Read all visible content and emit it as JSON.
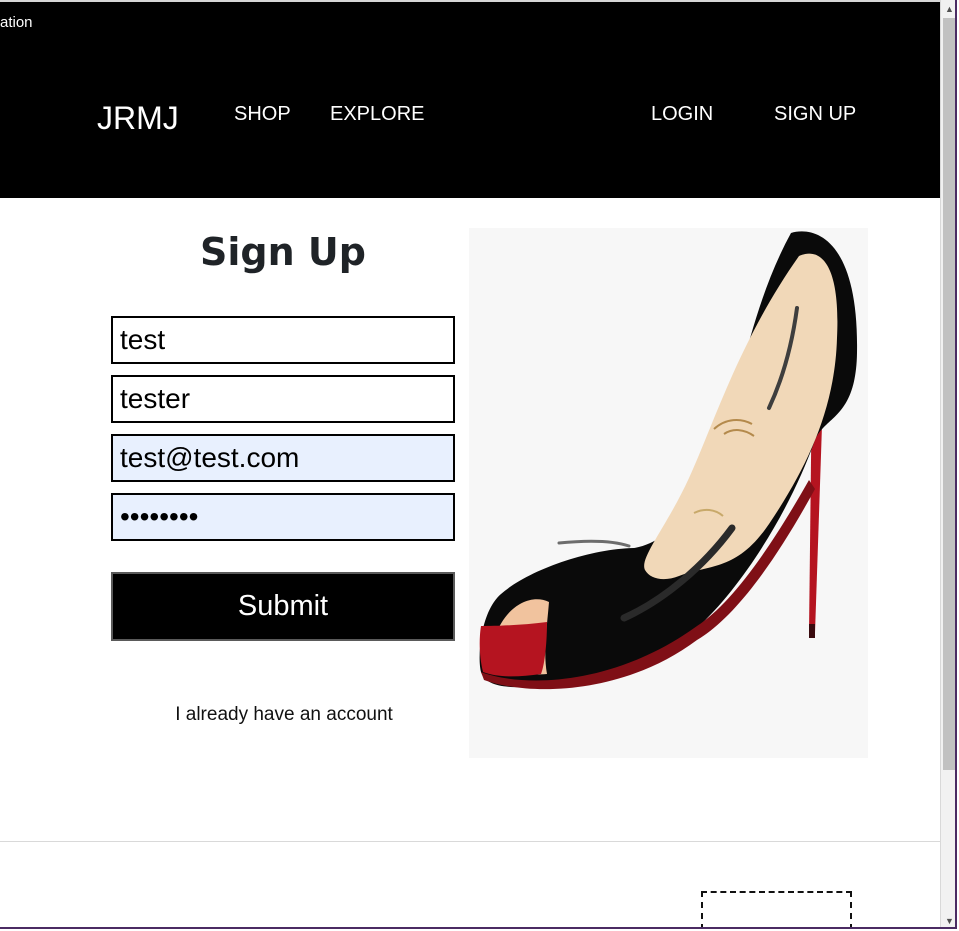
{
  "header": {
    "fragment_text": "ation",
    "brand": "JRMJ",
    "nav": {
      "shop": "SHOP",
      "explore": "EXPLORE",
      "login": "LOGIN",
      "signup": "SIGN UP"
    }
  },
  "form": {
    "title": "Sign Up",
    "first_name": "test",
    "last_name": "tester",
    "email": "test@test.com",
    "password_mask": "••••••••",
    "submit_label": "Submit",
    "already_account_text": "I already have an account"
  },
  "image": {
    "icon": "high-heel-shoe-icon",
    "colors": {
      "background": "#f7f7f7",
      "shoe_body": "#0b0b0b",
      "sole": "#b51420",
      "lining": "#f2dcc0"
    }
  },
  "colors": {
    "header_bg": "#000000",
    "autofill_bg": "#e8f0fe",
    "button_bg": "#000000",
    "scrollbar_thumb": "#c1c1c1"
  }
}
